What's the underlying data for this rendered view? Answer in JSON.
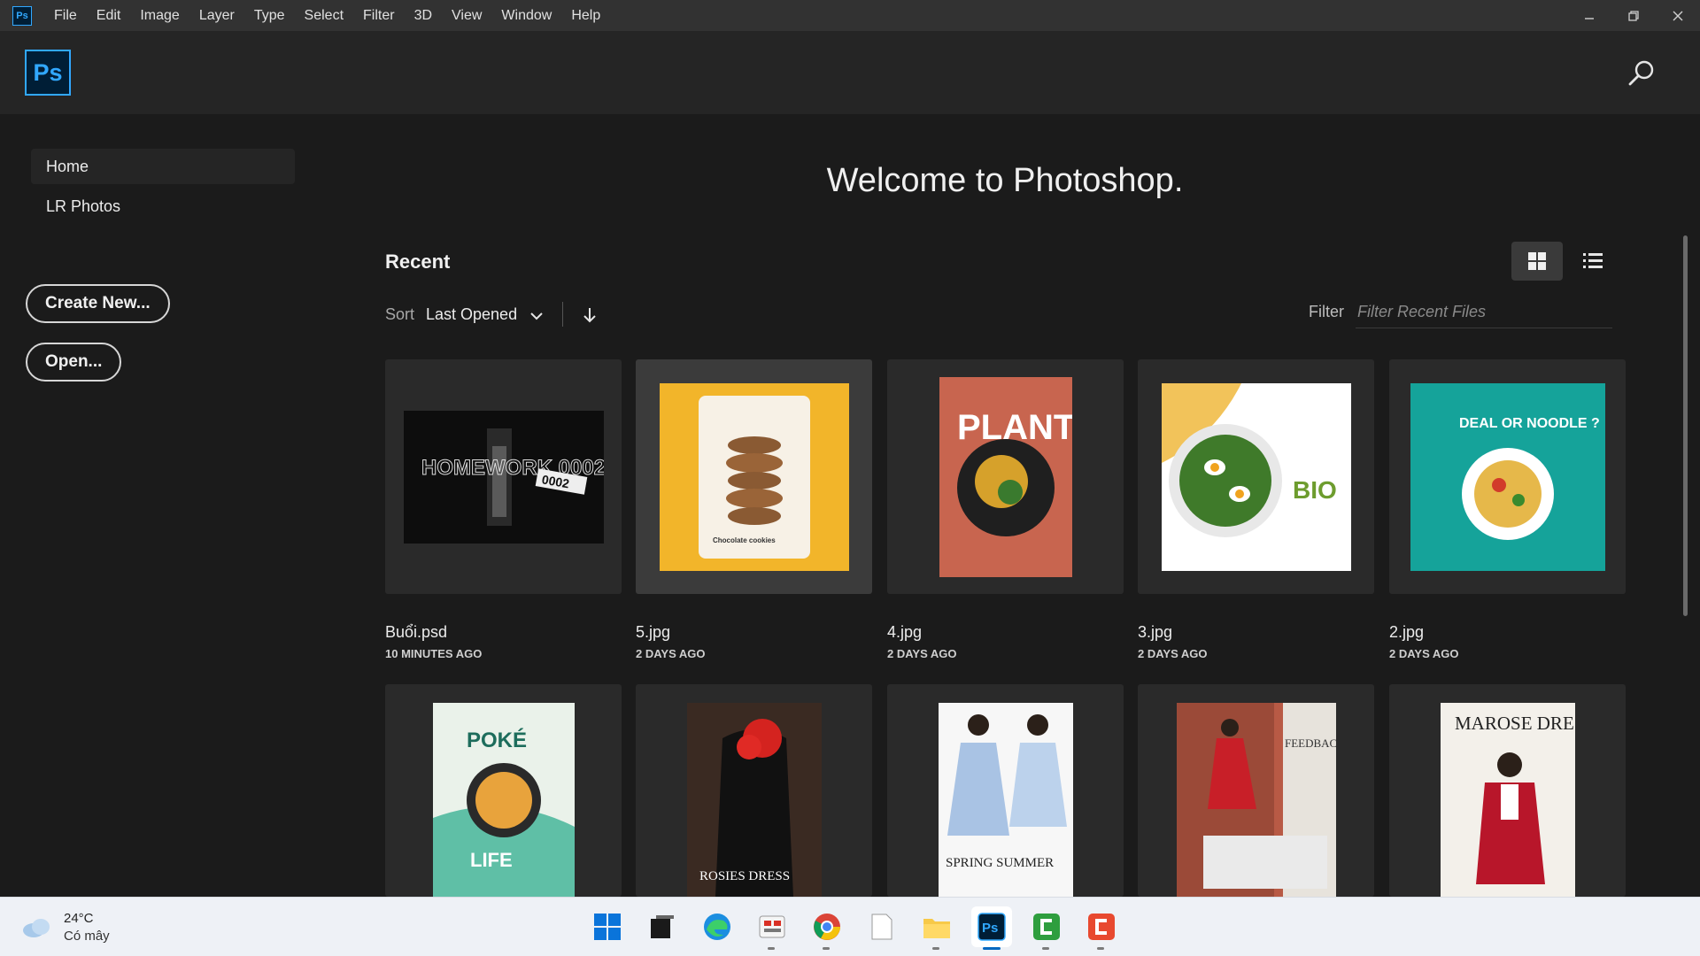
{
  "menubar": {
    "app_badge": "Ps",
    "items": [
      "File",
      "Edit",
      "Image",
      "Layer",
      "Type",
      "Select",
      "Filter",
      "3D",
      "View",
      "Window",
      "Help"
    ]
  },
  "header": {
    "logo": "Ps",
    "search_icon": "search-icon"
  },
  "sidebar": {
    "items": [
      {
        "label": "Home",
        "active": true
      },
      {
        "label": "LR Photos",
        "active": false
      }
    ],
    "create_new": "Create New...",
    "open": "Open..."
  },
  "main": {
    "welcome": "Welcome to Photoshop.",
    "recent_title": "Recent",
    "sort_label": "Sort",
    "sort_value": "Last Opened",
    "filter_label": "Filter",
    "filter_placeholder": "Filter Recent Files",
    "files": [
      {
        "name": "Buổi.psd",
        "time": "10 MINUTES AGO",
        "thumb_text": "HOMEWORK 0002"
      },
      {
        "name": "5.jpg",
        "time": "2 DAYS AGO",
        "thumb_text": "Chocolate cookies"
      },
      {
        "name": "4.jpg",
        "time": "2 DAYS AGO",
        "thumb_text": "PLANTS"
      },
      {
        "name": "3.jpg",
        "time": "2 DAYS AGO",
        "thumb_text": "BIO"
      },
      {
        "name": "2.jpg",
        "time": "2 DAYS AGO",
        "thumb_text": "DEAL OR NOODLE ?"
      }
    ],
    "row2": [
      {
        "thumb_text_top": "POKÉ",
        "thumb_text_bottom": "LIFE"
      },
      {
        "thumb_text_bottom": "ROSIES DRESS"
      },
      {
        "thumb_text_bottom": "SPRING SUMMER"
      },
      {
        "thumb_text_top": "FEEDBACK"
      },
      {
        "thumb_text_top": "MAROSE DRESS"
      }
    ]
  },
  "taskbar": {
    "temperature": "24°C",
    "condition": "Có mây",
    "icons": [
      "windows-start-icon",
      "task-view-icon",
      "edge-icon",
      "app-icon",
      "chrome-icon",
      "notepad-icon",
      "file-explorer-icon",
      "photoshop-icon",
      "camtasia-green-icon",
      "camtasia-red-icon"
    ]
  },
  "colors": {
    "accent": "#31a8ff",
    "background": "#1b1b1b",
    "card": "#2a2a2a"
  }
}
